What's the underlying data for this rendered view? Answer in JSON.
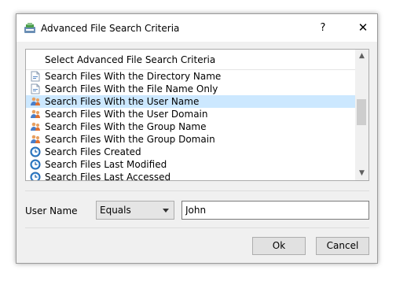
{
  "window": {
    "title": "Advanced File Search Criteria",
    "help_glyph": "?",
    "close_glyph": "✕"
  },
  "criteria_list": {
    "header": "Select Advanced File Search Criteria",
    "items": [
      {
        "label": "Search Files With the Directory Name",
        "icon": "file-icon",
        "selected": false
      },
      {
        "label": "Search Files With the File Name Only",
        "icon": "file-icon",
        "selected": false
      },
      {
        "label": "Search Files With the User Name",
        "icon": "users-icon",
        "selected": true
      },
      {
        "label": "Search Files With the User Domain",
        "icon": "users-icon",
        "selected": false
      },
      {
        "label": "Search Files With the Group Name",
        "icon": "users-icon",
        "selected": false
      },
      {
        "label": "Search Files With the Group Domain",
        "icon": "users-icon",
        "selected": false
      },
      {
        "label": "Search Files Created",
        "icon": "clock-icon",
        "selected": false
      },
      {
        "label": "Search Files Last Modified",
        "icon": "clock-icon",
        "selected": false
      },
      {
        "label": "Search Files Last Accessed",
        "icon": "clock-icon",
        "selected": false
      }
    ],
    "scroll_up_glyph": "▲",
    "scroll_down_glyph": "▼"
  },
  "criteria_form": {
    "field_label": "User Name",
    "operator": "Equals",
    "value": "John"
  },
  "buttons": {
    "ok": "Ok",
    "cancel": "Cancel"
  },
  "colors": {
    "selection": "#cce8ff",
    "dialog_bg": "#f0f0f0"
  }
}
